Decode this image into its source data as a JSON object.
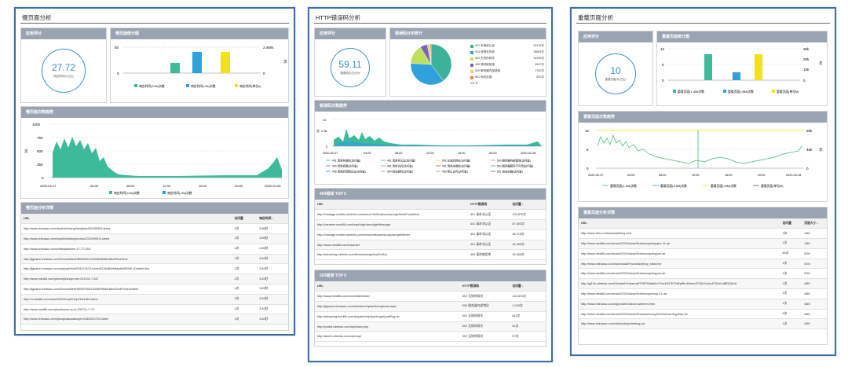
{
  "colors": {
    "teal": "#3cba9a",
    "blue": "#2fa1dc",
    "yellow": "#f0e216",
    "green_line": "#3cba75",
    "accent": "#3b8fd0",
    "header": "#9aa3b1"
  },
  "p1": {
    "title": "慢页面分析",
    "score": {
      "header": "应用评分",
      "value": "27.72",
      "sub": "响应时间(s/占比)"
    },
    "bar": {
      "header": "慢页面统计图",
      "y_top": "50",
      "y_zero": "0",
      "y_r_top": "2.4M/s",
      "y_r_zero": "0",
      "unit": "次",
      "legend": [
        "响应时间(3-5s)次数",
        "响应时间(>5s)次数",
        "响应时间(单位s)"
      ]
    },
    "ts": {
      "header": "慢页面次数趋势",
      "y": [
        "1000",
        "750",
        "500",
        "250",
        "0"
      ],
      "ylabel": "次",
      "x": [
        "2020-02-27",
        "04:00",
        "08:00",
        "12:00",
        "16:00",
        "20:00",
        "2020-02-28"
      ],
      "legend": [
        "响应时间(3-5s)次数",
        "响应时间(>5s)次数"
      ]
    },
    "table": {
      "header": "慢页面分析详情",
      "cols": [
        "URL",
        "访问量",
        "响应时间 ↓"
      ],
      "rows": [
        [
          "http://www.chinaacc.com/rtuplchinhang/huxji/aex901150625.shtml",
          "1次",
          "3.88秒"
        ],
        [
          "http://www.chinaacc.com/ruipitchinhang/xxx/sn2020299011.shtml",
          "1次",
          "3.85秒"
        ],
        [
          "http://www.chinaacc.com/zhbuijiadu/hnt-17-77-001/",
          "1次",
          "3.85秒"
        ],
        [
          "http://jigsaud.chinaacc.com/DoxnwMets/95040531/12046/9688/video/PlusTime",
          "1次",
          "3.84秒"
        ],
        [
          "http://jigsaud.chinaacc.com/upload/html/2012/12/01/huirzhf176e8b0b8dade0f00d0-cDeafch.doc",
          "1次",
          "3.84秒"
        ],
        [
          "http://www.med66.com/yisuxinjli/suqin.mm.201001-7-63/",
          "1次",
          "3.83秒"
        ],
        [
          "http://jigsaud.chinaacc.com/DoxnwMets/95040765/12036/9966/video/GedPoint/content",
          "1次",
          "3.83秒"
        ],
        [
          "http://ri.med66.com/new/200312/xy2010p2164180.shtml",
          "1次",
          "3.82秒"
        ],
        [
          "http://www.med66.com/yixuekao/a-ux-tx-200711-7-71/",
          "1次",
          "3.82秒"
        ],
        [
          "http://www.chinaacc.com/jbong/satuasking/nrn180/020702.shtml",
          "1次",
          "3.82秒"
        ]
      ]
    }
  },
  "p2": {
    "title": "HTTP错误码分析",
    "score": {
      "header": "应用评分",
      "value": "59.11",
      "sub": "错误响应占比(%)"
    },
    "pie": {
      "header": "错误码分布统计",
      "items": [
        [
          "401 未授权认证",
          "31476次"
        ],
        [
          "404 资源未找到",
          "28654次"
        ],
        [
          "503 无效的网关",
          "12205次"
        ],
        [
          "405 请求被拒绝",
          "4547次"
        ],
        [
          "500 服务器内部错误",
          "1782次"
        ],
        [
          "501 尚未实施",
          "622次"
        ]
      ],
      "more": "1/3 ▼",
      "values": [
        31476,
        28654,
        12205,
        4547,
        1782,
        622
      ],
      "slice_colors": [
        "#3cb29a",
        "#2fa1dc",
        "#bde05e",
        "#7d63b8",
        "#e8d45b",
        "#e8884a"
      ]
    },
    "ts": {
      "header": "错误码次数趋势",
      "y": [
        "10",
        "2.5k",
        "0"
      ],
      "ylabel": "次",
      "x": [
        "2020-02-27",
        "04:00",
        "08:00",
        "12:00",
        "16:00",
        "20:00",
        "2020-02-28"
      ],
      "legend": [
        "401 请求非授权(访问量)",
        "401 请求非认证(访问量)",
        "502 无效的网关(访问量)",
        "500 服务器内部错误(访问量)",
        "404 请求资源(访问量)",
        "401 请求访问(访问量)",
        "401 请求未授权(访问量)",
        "503 服务器暂时不可用(访问量)",
        "405 请求的范围无法(访问量)",
        "504 网关超时(访问量)",
        "403 禁止访问(访问量)",
        "501 尚未实施(访问量)"
      ]
    },
    "t404": {
      "header": "404错误 TOP 5",
      "cols": [
        "URL",
        "HTTP错误码",
        "访问量 ↓"
      ],
      "rows": [
        [
          "http://manage.mobile.cdeledu.com/amud.Verification/uiaux/getVerifiCodeBind",
          "401 请求非认证",
          "132,870次"
        ],
        [
          "http://member.med66.com/mapi/login/send/getMessage",
          "401 请求非认证",
          "87,600次"
        ],
        [
          "http://manage.mobile.cdeledu.com/lecture/sitcase/studyplan/getWinter",
          "401 请求非认证",
          "38,715次"
        ],
        [
          "http://www.med66.com/track/set",
          "401 请求非认证",
          "34,265次"
        ],
        [
          "http://elearning.cdeledu.com/fe/service/getAnyForiUs",
          "405 请求被拒绝",
          "26,365次"
        ]
      ]
    },
    "t503": {
      "header": "503错误 TOP 5",
      "cols": [
        "URL",
        "HTTP错误码",
        "访问量 ↓"
      ],
      "rows": [
        [
          "http://www.med66.com/ormo/stat/dealer",
          "502 无效的网关",
          "145,870次"
        ],
        [
          "http://jigsaud.chinaacc.com/interface/hylas/sheng/send.aspx",
          "500 服务器内部错误",
          "1,025次"
        ],
        [
          "http://elearning.med66.com/dispatch/zrj/stuinfo/getLawPlug.do",
          "502 无效的网关",
          "5k1次"
        ],
        [
          "http://portal.cdeledu.com/api/index.php",
          "502 无效的网关",
          "51次"
        ],
        [
          "http://sbefc.cdeledu.com/openapi",
          "502 无效的网关",
          "57次"
        ]
      ]
    }
  },
  "p3": {
    "title": "重载页面分析",
    "score": {
      "header": "应用评分",
      "value": "10",
      "sub": "重载页面(次/占比)"
    },
    "bar": {
      "header": "重载页面统计图",
      "y_top": "12",
      "y_mid": "6",
      "y_zero": "0",
      "y_r_top": "30k",
      "y_r_mid": "20k",
      "y_r_low": "10k",
      "y_r_zero": "0",
      "unit": "次",
      "legend": [
        "重载页面(1-4M)次数",
        "重载页面(>8M)次数",
        "重载页面(单位M)"
      ]
    },
    "ts": {
      "header": "重载页面次数趋势",
      "y": [
        "12",
        "6",
        "0"
      ],
      "yr": [
        "90k",
        "45k",
        "0"
      ],
      "ylabel": "次",
      "x": [
        "2020-02-27",
        "04:00",
        "08:00",
        "12:00",
        "16:00",
        "20:00",
        "2020-02-28"
      ],
      "legend": [
        "重载页面(1-4M)次数",
        "重载页面(4-8M)次数",
        "重载页面(>8M)次数",
        "重载页面(单位M)"
      ]
    },
    "table": {
      "header": "重载页面分析详情",
      "cols": [
        "URL",
        "访问量",
        "页面大小 ↓"
      ],
      "rows": [
        [
          "http://www.cthu.cn/download/fmzj.mdx",
          "3次",
          "15M"
        ],
        [
          "http://www.med66.com/shuzhi/2010/downSeries/suqu/hyiqhe-11.rar",
          "1次",
          "10M"
        ],
        [
          "http://www.med66.com/shuzhi/2010/downSeries/suqu/toppot.rar",
          "84次",
          "87M"
        ],
        [
          "http://www.chinaacc.com/download/Financial/setup_total.exe",
          "1次",
          "67M"
        ],
        [
          "http://www.med66.com/shuzhi/2010/downSeries/suqu/toppot.rar",
          "1次",
          "67M"
        ],
        [
          "http://gj12a.cdeledu.com/t3/auta/fYx/icaeuki/T69P90aMAvYGer4/ECE/TwBpiRrc8Venh/STQU1c/bnATS/tet.dtBDIQIHd",
          "1次",
          "45M"
        ],
        [
          "http://www.med66.com/shuzhi/2010/downSeries/suqu/tcnp-11.rar",
          "1次",
          "45M"
        ],
        [
          "http://www.chinaacc.com/app/video/xianct.ssetteet.xhtm",
          "1次",
          "45M"
        ],
        [
          "http://www.med66.com/shuzhi/2010/downSeries/tomcorg/2010/elearning/rkep.rar",
          "6次",
          "46M"
        ],
        [
          "http://www.chinaacc.com/video/zhujchinheng.rar",
          "1次",
          "43M"
        ]
      ]
    }
  }
}
